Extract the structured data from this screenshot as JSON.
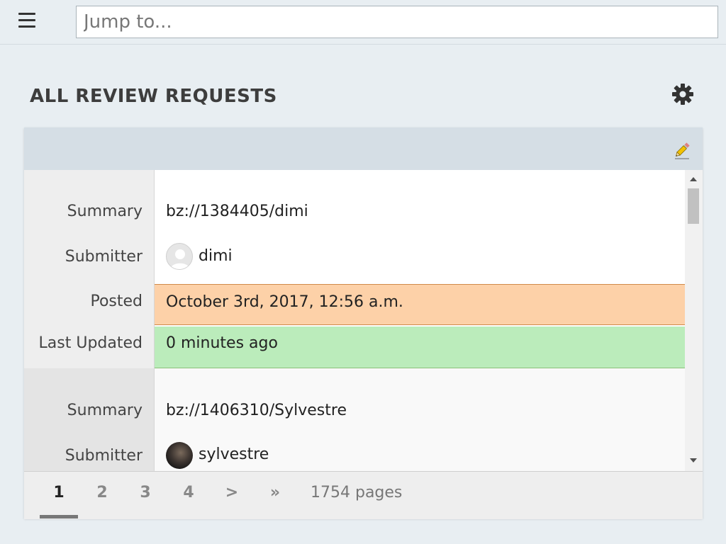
{
  "search": {
    "placeholder": "Jump to..."
  },
  "page": {
    "title": "ALL REVIEW REQUESTS"
  },
  "field_labels": {
    "summary": "Summary",
    "submitter": "Submitter",
    "posted": "Posted",
    "last_updated": "Last Updated"
  },
  "requests": [
    {
      "summary": "bz://1384405/dimi",
      "submitter": "dimi",
      "posted": "October 3rd, 2017, 12:56 a.m.",
      "last_updated": "0 minutes ago"
    },
    {
      "summary": "bz://1406310/Sylvestre",
      "submitter": "sylvestre"
    }
  ],
  "pagination": {
    "pages": [
      "1",
      "2",
      "3",
      "4"
    ],
    "current": "1",
    "next": ">",
    "last": "»",
    "total_label": "1754 pages"
  },
  "icons": {
    "menu": "hamburger-icon",
    "settings": "gear-icon",
    "edit": "pencil-icon"
  },
  "colors": {
    "posted_highlight": "#fdd1a8",
    "updated_highlight": "#bbecbb",
    "header_bar": "#d5dee5"
  }
}
